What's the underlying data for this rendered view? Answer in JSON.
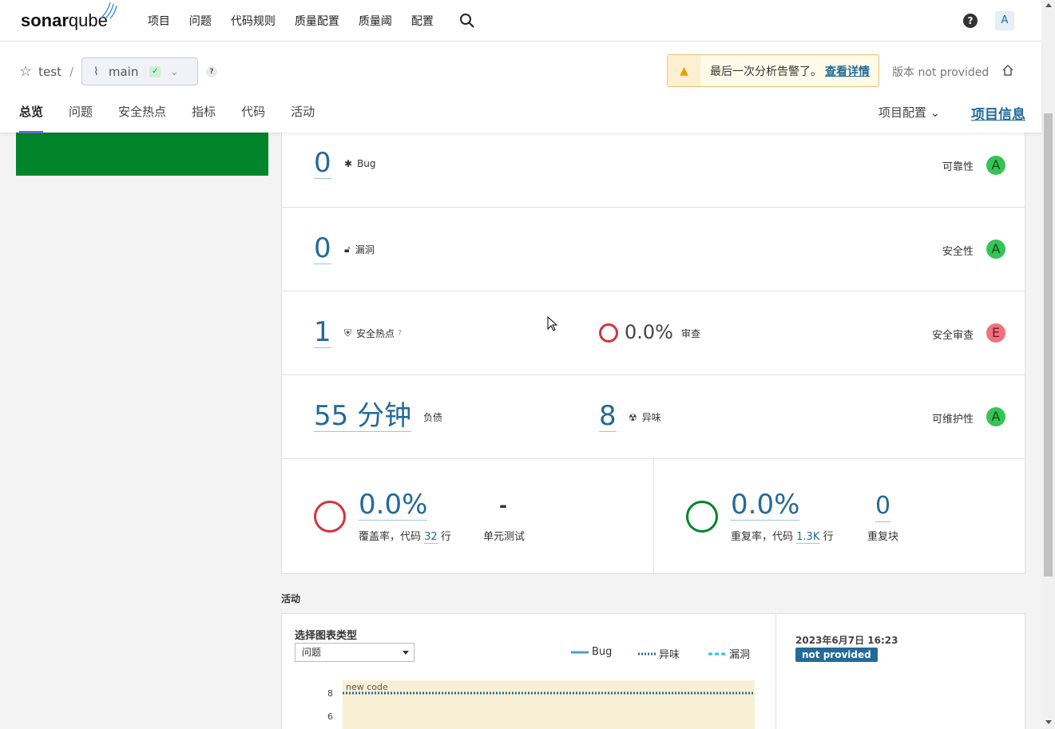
{
  "brand": {
    "name_bold": "sonar",
    "name_light": "qube"
  },
  "topnav": {
    "items": [
      "项目",
      "问题",
      "代码规则",
      "质量配置",
      "质量阈",
      "配置"
    ],
    "help": "?",
    "avatar": "A"
  },
  "project": {
    "name": "test",
    "separator": "/",
    "branch": "main",
    "branch_help": "?",
    "warning_text": "最后一次分析告警了。",
    "warning_link": "查看详情",
    "version": "版本 not provided",
    "tabs": [
      "总览",
      "问题",
      "安全热点",
      "指标",
      "代码",
      "活动"
    ],
    "config_label": "项目配置",
    "info_label": "项目信息"
  },
  "measures": {
    "bugs": {
      "value": "0",
      "label": "Bug",
      "rating_label": "可靠性",
      "rating": "A"
    },
    "vulns": {
      "value": "0",
      "label": "漏洞",
      "rating_label": "安全性",
      "rating": "A"
    },
    "hotspots": {
      "value": "1",
      "label": "安全热点",
      "reviewed_pct": "0.0%",
      "reviewed_label": "审查",
      "rating_label": "安全审查",
      "rating": "E"
    },
    "debt": {
      "value": "55 分钟",
      "label": "负债",
      "smells": "8",
      "smells_label": "异味",
      "rating_label": "可维护性",
      "rating": "A"
    },
    "coverage": {
      "value": "0.0%",
      "label_prefix": "覆盖率，代码",
      "lines": "32",
      "label_suffix": "行",
      "unit_tests": "-",
      "unit_tests_label": "单元测试"
    },
    "duplication": {
      "value": "0.0%",
      "label_prefix": "重复率，代码",
      "lines": "1.3K",
      "label_suffix": "行",
      "blocks": "0",
      "blocks_label": "重复块"
    }
  },
  "activity": {
    "title": "活动",
    "select_label": "选择图表类型",
    "select_value": "问题",
    "legend": [
      "Bug",
      "异味",
      "漏洞"
    ],
    "new_code_label": "new code",
    "y_ticks": [
      "8",
      "6"
    ],
    "date": "2023年6月7日 16:23",
    "version_badge": "not provided"
  },
  "colors": {
    "accent": "#236a97",
    "rating_a": "#37c456",
    "rating_e": "#f0727e",
    "quality_gate_passed": "#00842c"
  }
}
